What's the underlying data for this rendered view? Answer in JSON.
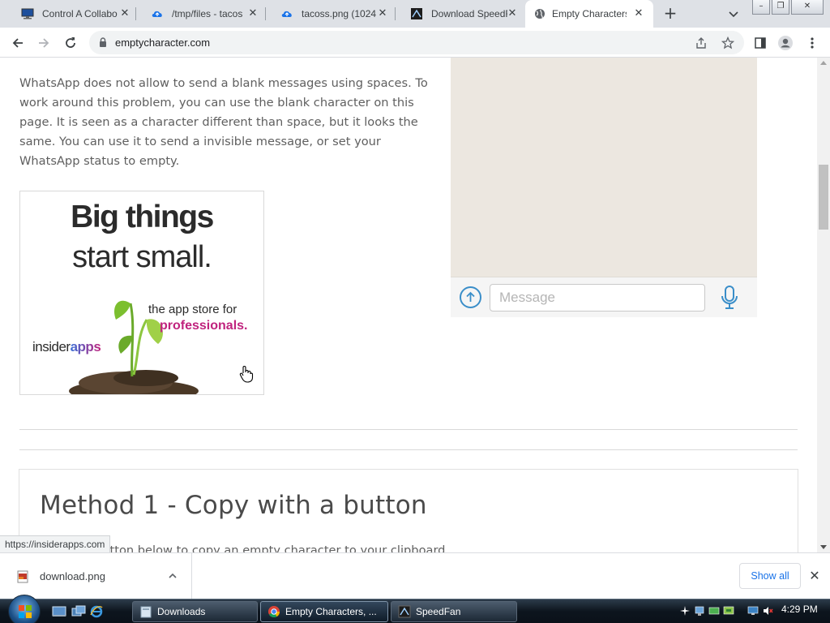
{
  "browser": {
    "tabs": [
      {
        "title": "Control A Collabo",
        "active": false,
        "icon": "remote-desktop-icon"
      },
      {
        "title": "/tmp/files - tacos",
        "active": false,
        "icon": "cloud-icon"
      },
      {
        "title": "tacoss.png (1024",
        "active": false,
        "icon": "cloud-icon"
      },
      {
        "title": "Download SpeedF",
        "active": false,
        "icon": "speedfan-icon"
      },
      {
        "title": "Empty Characters",
        "active": true,
        "icon": "globe-icon"
      }
    ],
    "url": "emptycharacter.com",
    "window_controls": {
      "minimize": "–",
      "maximize": "❐",
      "close": "✕"
    }
  },
  "page": {
    "intro_text": "WhatsApp does not allow to send a blank messages using spaces. To work around this problem, you can use the blank character on this page. It is seen as a character different than space, but it looks the same. You can use it to send a invisible message, or set your WhatsApp status to empty.",
    "ad": {
      "headline_1": "Big things",
      "headline_2": "start small.",
      "tagline_1": "the app store for",
      "tagline_2": "professionals.",
      "brand_prefix": "insider",
      "brand_suffix": "apps"
    },
    "whatsapp_mock": {
      "message_placeholder": "Message"
    },
    "method_heading": "Method 1 - Copy with a button",
    "method_text": "Click the button below to copy an empty character to your clipboard."
  },
  "status_url": "https://insiderapps.com",
  "downloads": {
    "file_name": "download.png",
    "show_all_label": "Show all"
  },
  "taskbar": {
    "buttons": [
      {
        "label": "Downloads",
        "active": false
      },
      {
        "label": "Empty Characters, ...",
        "active": true
      },
      {
        "label": "SpeedFan",
        "active": false
      }
    ],
    "clock": "4:29 PM"
  }
}
